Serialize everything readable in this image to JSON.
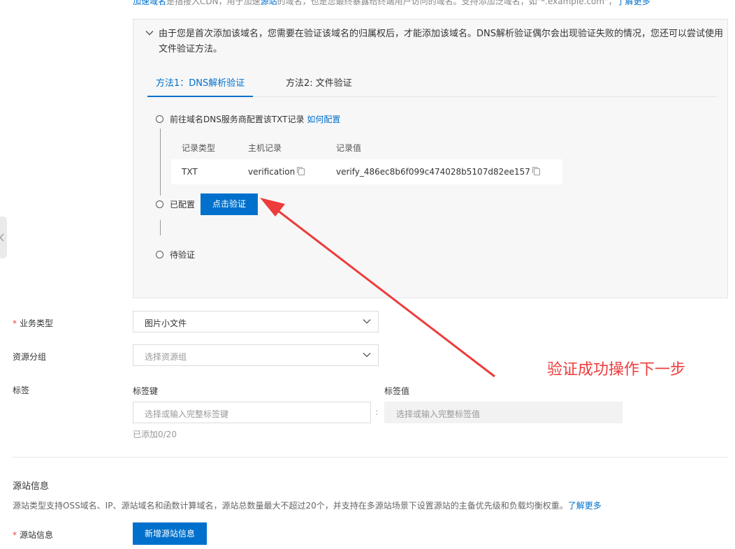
{
  "top_hint": {
    "link1": "加速域名",
    "text1": "是指接入CDN，用于加速",
    "link2": "源站",
    "text2": "的域名，也是您最终暴露给终端用户访问的域名。支持添加泛域名，如\"*.example.com\"，",
    "learn_more": "了解更多"
  },
  "notice": {
    "text": "由于您是首次添加该域名，您需要在验证该域名的归属权后，才能添加该域名。DNS解析验证偶尔会出现验证失败的情况，您还可以尝试使用文件验证方法。"
  },
  "tabs": [
    {
      "label": "方法1：DNS解析验证",
      "active": true
    },
    {
      "label": "方法2: 文件验证",
      "active": false
    }
  ],
  "steps": {
    "step1_label": "前往域名DNS服务商配置该TXT记录",
    "step1_link": "如何配置",
    "step2_label": "已配置",
    "step2_button": "点击验证",
    "step3_label": "待验证"
  },
  "record_table": {
    "headers": [
      "记录类型",
      "主机记录",
      "记录值"
    ],
    "row": {
      "type": "TXT",
      "host": "verification",
      "value": "verify_486ec8b6f099c474028b5107d82ee157"
    }
  },
  "form": {
    "business_type": {
      "label": "业务类型",
      "value": "图片小文件"
    },
    "resource_group": {
      "label": "资源分组",
      "placeholder": "选择资源组"
    },
    "tags": {
      "label": "标签",
      "key_label": "标签键",
      "value_label": "标签值",
      "key_placeholder": "选择或输入完整标签键",
      "value_placeholder": "选择或输入完整标签值",
      "separator": ":",
      "count": "已添加0/20"
    }
  },
  "origin": {
    "section_title": "源站信息",
    "description": "源站类型支持OSS域名、IP、源站域名和函数计算域名，源站总数量最大不超过20个，并支持在多源站场景下设置源站的主备优先级和负载均衡权重。",
    "learn_more": "了解更多",
    "label": "源站信息",
    "add_button": "新增源站信息"
  },
  "annotation": {
    "text": "验证成功操作下一步",
    "color": "#ee3b3b"
  },
  "colors": {
    "accent": "#0070cc",
    "required": "#e54545"
  }
}
